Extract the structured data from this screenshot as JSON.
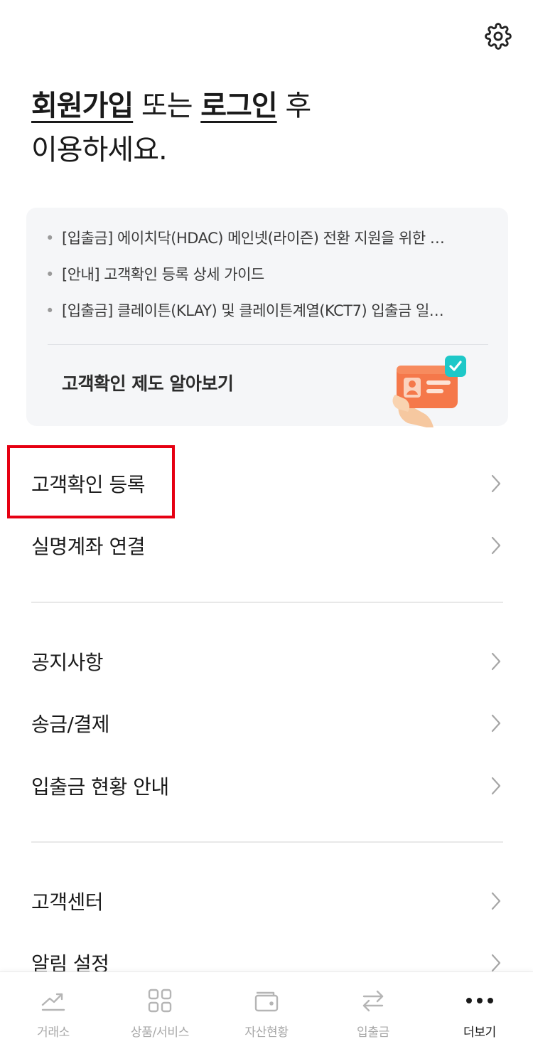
{
  "header": {
    "settings_icon": "gear-icon"
  },
  "headline": {
    "signup_link": "회원가입",
    "or_text": " 또는 ",
    "login_link": "로그인",
    "after_text": " 후",
    "line2": "이용하세요."
  },
  "notices": {
    "bullet": "•",
    "items": [
      "[입출금] 에이치닥(HDAC) 메인넷(라이즌) 전환 지원을 위한 …",
      "[안내] 고객확인 등록 상세 가이드",
      "[입출금] 클레이튼(KLAY) 및 클레이튼계열(KCT7) 입출금 일…"
    ],
    "guide_label": "고객확인 제도 알아보기",
    "guide_icon": "id-card-check-icon"
  },
  "menu": {
    "group1": [
      "고객확인 등록",
      "실명계좌 연결"
    ],
    "group2": [
      "공지사항",
      "송금/결제",
      "입출금 현황 안내"
    ],
    "group3": [
      "고객센터",
      "알림 설정"
    ]
  },
  "colors": {
    "highlight": "#e60012",
    "card_bg": "#f5f6f8",
    "inactive": "#a8a8a8",
    "active": "#1a1a1a"
  },
  "bottom_nav": {
    "active_index": 4,
    "items": [
      {
        "label": "거래소",
        "icon": "chart-line-icon"
      },
      {
        "label": "상품/서비스",
        "icon": "grid-icon"
      },
      {
        "label": "자산현황",
        "icon": "wallet-icon"
      },
      {
        "label": "입출금",
        "icon": "transfer-arrows-icon"
      },
      {
        "label": "더보기",
        "icon": "more-dots-icon"
      }
    ]
  }
}
